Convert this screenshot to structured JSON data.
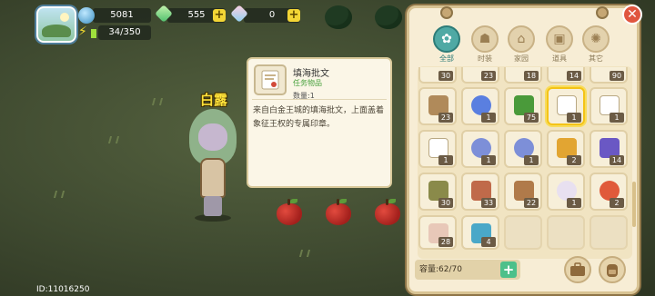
{
  "hud": {
    "coins": "5081",
    "gems": "555",
    "crystals": "0",
    "energy": "34/350",
    "plus_glyph": "+"
  },
  "character": {
    "name": "白露",
    "uid": "ID:11016250"
  },
  "tooltip": {
    "title": "填海批文",
    "type": "任务物品",
    "quantity": "数量:1",
    "description": "来自白金王城的填海批文，上面盖着象征王权的专属印章。"
  },
  "inventory": {
    "close_glyph": "✕",
    "tabs": [
      {
        "label": "全部",
        "glyph": "✿"
      },
      {
        "label": "时装",
        "glyph": "☗"
      },
      {
        "label": "家园",
        "glyph": "⌂"
      },
      {
        "label": "道具",
        "glyph": "▣"
      },
      {
        "label": "其它",
        "glyph": "✺"
      }
    ],
    "top_row_counts": [
      "30",
      "23",
      "18",
      "14",
      "90"
    ],
    "rows": [
      [
        {
          "item": "wood-log",
          "count": "23",
          "color": "#b08a5a"
        },
        {
          "item": "blue-flower",
          "count": "1",
          "color": "#5a7fe0"
        },
        {
          "item": "green-leaves",
          "count": "75",
          "color": "#4a9a3a"
        },
        {
          "item": "document-scroll",
          "count": "1",
          "color": "#c9b38a",
          "selected": true
        },
        {
          "item": "document-scroll",
          "count": "1",
          "color": "#c9b38a"
        }
      ],
      [
        {
          "item": "document-scroll",
          "count": "1",
          "color": "#c9b38a"
        },
        {
          "item": "lightning-seed",
          "count": "1",
          "color": "#7d8fd8"
        },
        {
          "item": "lightning-seed",
          "count": "1",
          "color": "#7d8fd8"
        },
        {
          "item": "golden-ticket",
          "count": "2",
          "color": "#e2a532"
        },
        {
          "item": "purple-device",
          "count": "14",
          "color": "#6a58c4"
        }
      ],
      [
        {
          "item": "barrel-pot",
          "count": "30",
          "color": "#8a8a4a"
        },
        {
          "item": "hourglass",
          "count": "33",
          "color": "#c06a4a"
        },
        {
          "item": "potion-bowl",
          "count": "22",
          "color": "#b07a4a"
        },
        {
          "item": "ghost-mask",
          "count": "1",
          "color": "#e8e0f0"
        },
        {
          "item": "apple-bag",
          "count": "2",
          "color": "#e05a3a"
        }
      ],
      [
        {
          "item": "seashell",
          "count": "28",
          "color": "#e8c8b8"
        },
        {
          "item": "blue-card",
          "count": "4",
          "color": "#4aa8c8"
        }
      ]
    ],
    "capacity": "容量:62/70",
    "capacity_plus": "+"
  },
  "colors": {
    "accent": "#4fa9a4",
    "panel_bg": "#f7edd5",
    "name_yellow": "#ffe23a"
  }
}
